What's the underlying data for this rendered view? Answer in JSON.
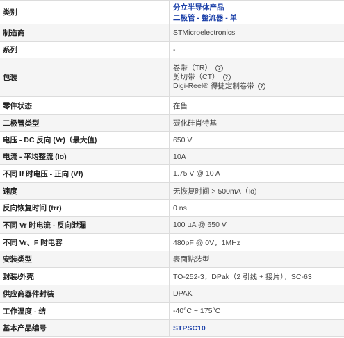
{
  "rows": [
    {
      "label": "类别",
      "lines": [
        "分立半导体产品",
        "二极管 - 整流器 - 单"
      ],
      "link": true
    },
    {
      "label": "制造商",
      "value": "STMicroelectronics"
    },
    {
      "label": "系列",
      "value": "-"
    },
    {
      "label": "包装",
      "lines": [
        "卷带（TR）",
        "剪切带（CT）",
        "Digi-Reel® 得捷定制卷带"
      ],
      "help_icon": "question-circle-icon"
    },
    {
      "label": "零件状态",
      "value": "在售"
    },
    {
      "label": "二极管类型",
      "value": "碳化硅肖特基"
    },
    {
      "label": "电压 - DC 反向 (Vr)（最大值)",
      "value": "650 V"
    },
    {
      "label": "电流 - 平均整流 (Io)",
      "value": "10A"
    },
    {
      "label": "不同 If 时电压 - 正向 (Vf)",
      "value": "1.75 V @ 10 A"
    },
    {
      "label": "速度",
      "value": "无恢复时间 > 500mA（Io)"
    },
    {
      "label": "反向恢复时间 (trr)",
      "value": "0 ns"
    },
    {
      "label": "不同 Vr 时电流 - 反向泄漏",
      "value": "100 µA @ 650 V"
    },
    {
      "label": "不同 Vr、F 时电容",
      "value": "480pF @ 0V，1MHz"
    },
    {
      "label": "安装类型",
      "value": "表面贴装型"
    },
    {
      "label": "封装/外壳",
      "value": "TO-252-3，DPak（2 引线 + 接片），SC-63"
    },
    {
      "label": "供应商器件封装",
      "value": "DPAK"
    },
    {
      "label": "工作温度 - 结",
      "value": "-40°C ~ 175°C"
    },
    {
      "label": "基本产品编号",
      "value": "STPSC10",
      "link": true
    }
  ]
}
